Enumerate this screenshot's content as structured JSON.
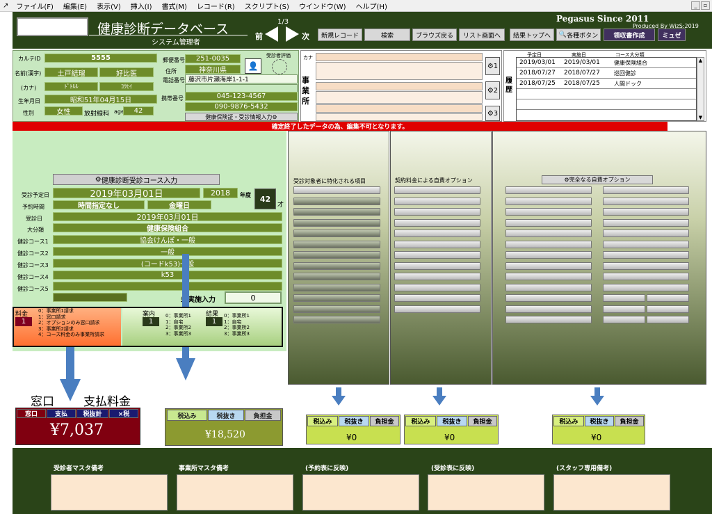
{
  "menu": [
    "ファイル(F)",
    "編集(E)",
    "表示(V)",
    "挿入(I)",
    "書式(M)",
    "レコード(R)",
    "スクリプト(S)",
    "ウインドウ(W)",
    "ヘルプ(H)"
  ],
  "header": {
    "title": "健康診断データベース",
    "subtitle": "システム管理者",
    "brand": "Pegasus  Since 2011",
    "produced": "Produced By WizS:2019",
    "page": "1/3",
    "prev": "前",
    "next": "次"
  },
  "toolbar": [
    "新規レコード",
    "検索",
    "ブラウズ戻る",
    "リスト画面へ",
    "結果トップへ",
    "各種ボタン",
    "領収書作成",
    "ミュゼ"
  ],
  "patient": {
    "l_id": "カルテID",
    "id": "5555",
    "l_name": "名前(漢字)",
    "last": "土戸結瑠",
    "first": "好比医",
    "l_kana": "(カナ)",
    "kana_last": "ﾄﾞﾄﾙﾙ",
    "kana_first": "ｺｳﾋｲ",
    "l_dob": "生年月日",
    "dob": "昭和51年04月15日",
    "l_sex": "性別",
    "sex": "女性",
    "dept": "放射線科",
    "l_age": "age",
    "age": "42",
    "l_zip": "郵便番号",
    "zip": "251-0035",
    "l_addr": "住所",
    "pref": "神奈川県",
    "l_tel": "電話番号",
    "addr": "藤沢市片瀬海岸1-1-1",
    "tel": "045-123-4567",
    "l_mobile": "携帯番号",
    "mobile": "090-9876-5432",
    "insurance_btn": "健康保険証・受診情報入力",
    "eval_lbl": "受診者評価"
  },
  "office": {
    "kana_lbl": "カナ",
    "label": "事業所",
    "b1": "1",
    "b2": "2",
    "b3": "3"
  },
  "history": {
    "label": "履歴",
    "headers": [
      "予定日",
      "実施日",
      "コース大分類"
    ],
    "rows": [
      [
        "2019/03/01",
        "2019/03/01",
        "健康保険組合"
      ],
      [
        "2018/07/27",
        "2018/07/27",
        "巡回健診"
      ],
      [
        "2018/07/25",
        "2018/07/25",
        "人間ドック"
      ]
    ]
  },
  "notice": "確定終了したデータの為、編集不可となります。",
  "course": {
    "btn": "健康診断受診コース入力",
    "l_plan": "受診予定日",
    "plan": "2019年03月01日",
    "year": "2018",
    "l_year": "年度",
    "age": "42",
    "l_age_suf": "才",
    "l_time": "予約時間",
    "time": "時間指定なし",
    "weekday": "金曜日",
    "l_date": "受診日",
    "date": "2019年03月01日",
    "l_cat": "大分類",
    "cat": "健康保険組合",
    "l_c1": "健診コース1",
    "c1": "協会けんぽ・一般",
    "l_c2": "健診コース2",
    "c2": "一般",
    "l_c3": "健診コース3",
    "c3": "(コードk53)一般",
    "l_c4": "健診コース4",
    "c4": "k53",
    "l_c5": "健診コース5",
    "c5": "",
    "l_unexec": "未実施入力",
    "unexec": "0"
  },
  "fee": {
    "label": "料金",
    "value": "1",
    "options": [
      "0：事業所1請求",
      "1：窓口請求",
      "2：オプションのみ窓口請求",
      "3：事業所2請求",
      "4：コース料金のみ事業所請求"
    ]
  },
  "guide": {
    "label": "案内",
    "value": "1",
    "options": [
      "0：事業所1",
      "1：自宅",
      "2：事業所2",
      "3：事業所3"
    ]
  },
  "result": {
    "label": "結果",
    "value": "1",
    "options": [
      "0：事業所1",
      "1：自宅",
      "2：事業所2",
      "3：事業所3"
    ]
  },
  "options": {
    "p1": "受診対象者に特化される項目",
    "p2": "契約料金による自費オプション",
    "p3": "完全なる自費オプション"
  },
  "window": {
    "big1": "窓口",
    "big2": "支払料金",
    "tabs": [
      "窓口",
      "支払",
      "税抜計",
      "×税"
    ],
    "amount": "¥7,037"
  },
  "total": {
    "tabs": [
      "税込み",
      "税抜き",
      "負担金"
    ],
    "amount": "¥18,520"
  },
  "sub": [
    {
      "tabs": [
        "税込み",
        "税抜き",
        "負担金"
      ],
      "amount": "¥0"
    },
    {
      "tabs": [
        "税込み",
        "税抜き",
        "負担金"
      ],
      "amount": "¥0"
    },
    {
      "tabs": [
        "税込み",
        "税抜き",
        "負担金"
      ],
      "amount": "¥0"
    }
  ],
  "notes": [
    "受診者マスタ備考",
    "事業所マスタ備考",
    "(予約表に反映)",
    "(受診表に反映)",
    "(スタッフ専用備考)"
  ]
}
